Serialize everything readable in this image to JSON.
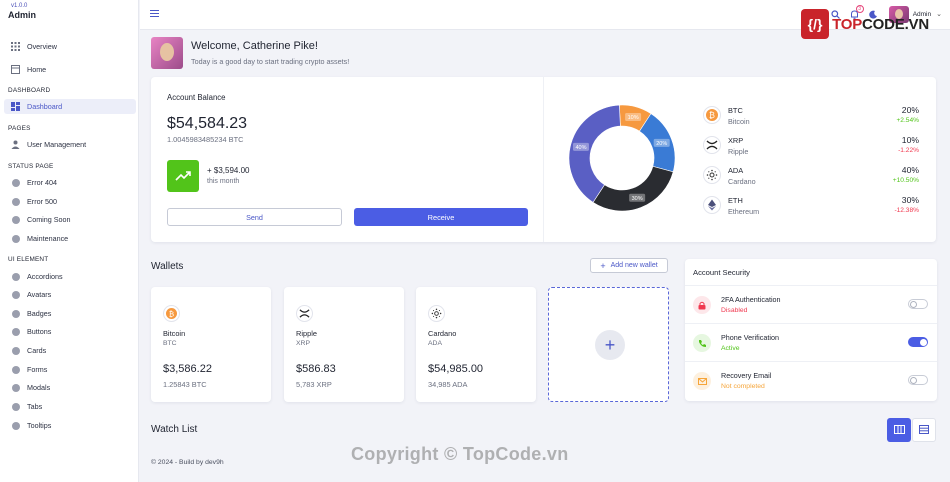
{
  "brand": {
    "version": "v1.0.0",
    "name": "Admin"
  },
  "sidebar": {
    "top_items": [
      {
        "label": "Overview",
        "icon": "grid-icon"
      },
      {
        "label": "Home",
        "icon": "home-icon"
      }
    ],
    "sections": {
      "dashboard": "DASHBOARD",
      "pages": "PAGES",
      "status": "STATUS PAGE",
      "ui": "UI ELEMENT"
    },
    "dashboard_item": "Dashboard",
    "pages_item": "User Management",
    "status_items": [
      "Error 404",
      "Error 500",
      "Coming Soon",
      "Maintenance"
    ],
    "ui_items": [
      "Accordions",
      "Avatars",
      "Badges",
      "Buttons",
      "Cards",
      "Forms",
      "Modals",
      "Tabs",
      "Tooltips"
    ]
  },
  "topbar": {
    "user": "Admin",
    "notification_count": "3"
  },
  "watermark": {
    "logo_text_red": "TOP",
    "logo_text_dark": "CODE.VN",
    "copyright": "Copyright © TopCode.vn"
  },
  "welcome": {
    "title": "Welcome, Catherine Pike!",
    "subtitle": "Today is a good day to start trading crypto assets!"
  },
  "balance": {
    "label": "Account Balance",
    "amount": "$54,584.23",
    "btc": "1.0045983485234 BTC",
    "change": "+ $3,594.00",
    "change_period": "this month",
    "send_label": "Send",
    "receive_label": "Receive"
  },
  "chart_data": {
    "type": "pie",
    "categories": [
      "BTC",
      "XRP",
      "ADA",
      "ETH"
    ],
    "values": [
      10,
      20,
      30,
      40
    ],
    "labels": [
      "10%",
      "20%",
      "30%",
      "40%"
    ],
    "colors": [
      "#f6993f",
      "#3a7bd5",
      "#2a2c31",
      "#5a5fc4"
    ]
  },
  "coins": [
    {
      "symbol": "BTC",
      "name": "Bitcoin",
      "pct": "20%",
      "change": "+2.54%",
      "dir": "pos",
      "icon": "bitcoin-icon"
    },
    {
      "symbol": "XRP",
      "name": "Ripple",
      "pct": "10%",
      "change": "-1.22%",
      "dir": "neg",
      "icon": "ripple-icon"
    },
    {
      "symbol": "ADA",
      "name": "Cardano",
      "pct": "40%",
      "change": "+10.50%",
      "dir": "pos",
      "icon": "cardano-icon"
    },
    {
      "symbol": "ETH",
      "name": "Ethereum",
      "pct": "30%",
      "change": "-12.38%",
      "dir": "neg",
      "icon": "ethereum-icon"
    }
  ],
  "wallets": {
    "title": "Wallets",
    "add_label": "Add new wallet",
    "cards": [
      {
        "name": "Bitcoin",
        "symbol": "BTC",
        "usd": "$3,586.22",
        "amount": "1.25843 BTC",
        "icon": "bitcoin-icon"
      },
      {
        "name": "Ripple",
        "symbol": "XRP",
        "usd": "$586.83",
        "amount": "5,783 XRP",
        "icon": "ripple-icon"
      },
      {
        "name": "Cardano",
        "symbol": "ADA",
        "usd": "$54,985.00",
        "amount": "34,985 ADA",
        "icon": "cardano-icon"
      }
    ]
  },
  "security": {
    "title": "Account Security",
    "items": [
      {
        "name": "2FA Authentication",
        "status": "Disabled",
        "color": "#f0384f",
        "bg": "#fde7ea",
        "enabled": false,
        "icon": "lock-icon"
      },
      {
        "name": "Phone Verification",
        "status": "Active",
        "color": "#52c41a",
        "bg": "#e6f7e0",
        "enabled": true,
        "icon": "phone-icon"
      },
      {
        "name": "Recovery Email",
        "status": "Not completed",
        "color": "#f6a53a",
        "bg": "#fdf0de",
        "enabled": false,
        "icon": "email-icon"
      }
    ]
  },
  "watchlist": {
    "title": "Watch List"
  },
  "footer": {
    "text": "© 2024 - Build by dev9h"
  }
}
